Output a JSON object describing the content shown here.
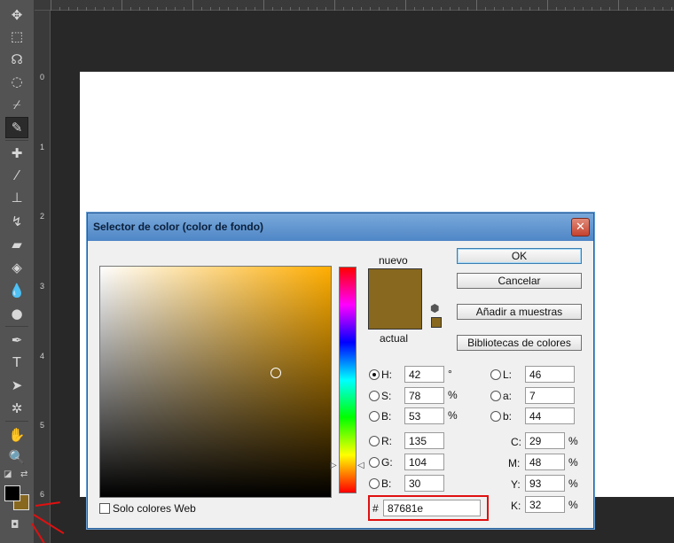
{
  "rulers": {
    "left_numbers": [
      "0",
      "1",
      "2",
      "3",
      "4",
      "5",
      "6"
    ]
  },
  "toolbar": {
    "tools": [
      {
        "name": "move-tool-icon",
        "glyph": "✥"
      },
      {
        "name": "marquee-tool-icon",
        "glyph": "⬚"
      },
      {
        "name": "lasso-tool-icon",
        "glyph": "☊"
      },
      {
        "name": "quick-select-tool-icon",
        "glyph": "◌"
      },
      {
        "name": "crop-tool-icon",
        "glyph": "⌿"
      },
      {
        "name": "eyedropper-tool-icon",
        "glyph": "✎"
      },
      {
        "name": "healing-tool-icon",
        "glyph": "✚"
      },
      {
        "name": "brush-tool-icon",
        "glyph": "⁄"
      },
      {
        "name": "stamp-tool-icon",
        "glyph": "⊥"
      },
      {
        "name": "history-brush-tool-icon",
        "glyph": "↯"
      },
      {
        "name": "eraser-tool-icon",
        "glyph": "▰"
      },
      {
        "name": "bucket-tool-icon",
        "glyph": "◈"
      },
      {
        "name": "blur-tool-icon",
        "glyph": "💧"
      },
      {
        "name": "dodge-tool-icon",
        "glyph": "●"
      },
      {
        "name": "pen-tool-icon",
        "glyph": "✒"
      },
      {
        "name": "type-tool-icon",
        "glyph": "T"
      },
      {
        "name": "path-select-tool-icon",
        "glyph": "➤"
      },
      {
        "name": "shape-tool-icon",
        "glyph": "✲"
      },
      {
        "name": "hand-tool-icon",
        "glyph": "✋"
      },
      {
        "name": "zoom-tool-icon",
        "glyph": "🔍"
      }
    ],
    "foreground_color": "#000000",
    "background_color": "#87681e"
  },
  "dialog": {
    "title": "Selector de color (color de fondo)",
    "close_glyph": "✕",
    "new_label": "nuevo",
    "current_label": "actual",
    "new_color": "#87681e",
    "current_color": "#87681e",
    "buttons": {
      "ok": "OK",
      "cancel": "Cancelar",
      "add_swatch": "Añadir a muestras",
      "libraries": "Bibliotecas de colores"
    },
    "hsb": [
      {
        "key": "H:",
        "value": "42",
        "unit": "°",
        "selected": true
      },
      {
        "key": "S:",
        "value": "78",
        "unit": "%",
        "selected": false
      },
      {
        "key": "B:",
        "value": "53",
        "unit": "%",
        "selected": false
      }
    ],
    "rgb": [
      {
        "key": "R:",
        "value": "135"
      },
      {
        "key": "G:",
        "value": "104"
      },
      {
        "key": "B:",
        "value": "30"
      }
    ],
    "lab": [
      {
        "key": "L:",
        "value": "46"
      },
      {
        "key": "a:",
        "value": "7"
      },
      {
        "key": "b:",
        "value": "44"
      }
    ],
    "cmyk": [
      {
        "key": "C:",
        "value": "29",
        "unit": "%"
      },
      {
        "key": "M:",
        "value": "48",
        "unit": "%"
      },
      {
        "key": "Y:",
        "value": "93",
        "unit": "%"
      },
      {
        "key": "K:",
        "value": "32",
        "unit": "%"
      }
    ],
    "hex_prefix": "#",
    "hex_value": "87681e",
    "web_only_label": "Solo colores Web",
    "web_only_checked": false
  }
}
